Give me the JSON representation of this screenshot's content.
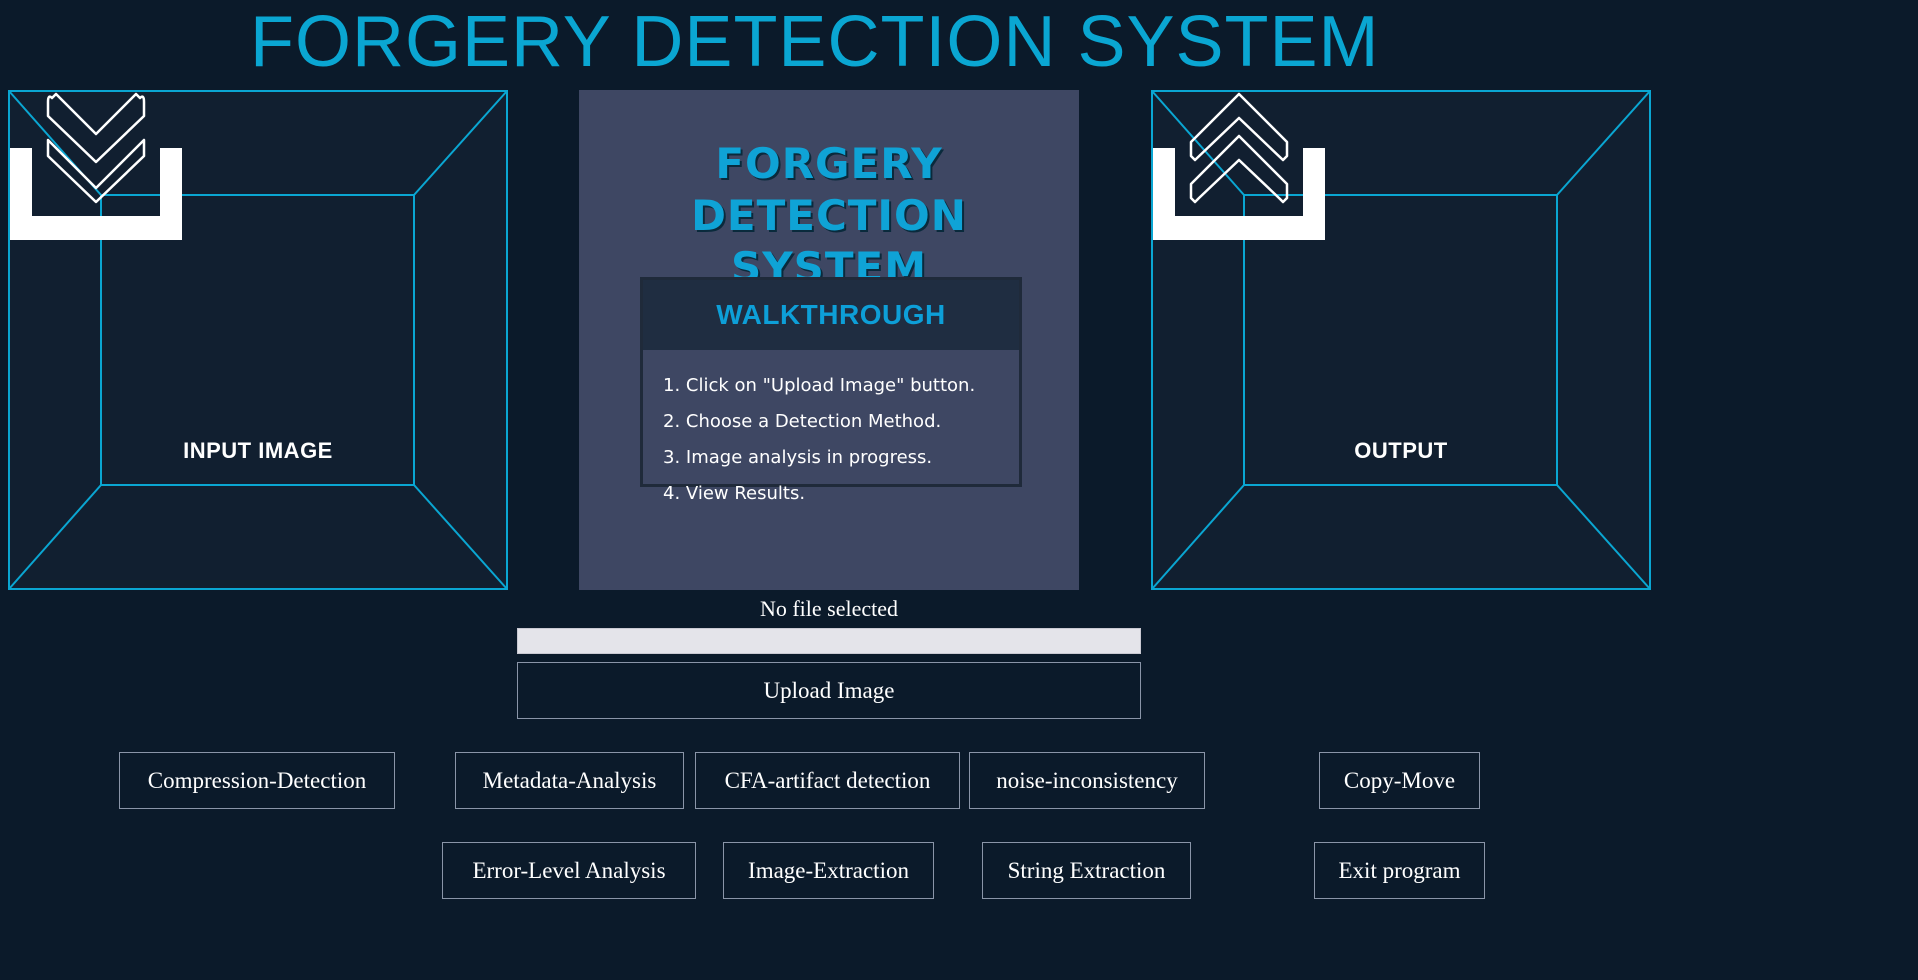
{
  "app": {
    "title": "FORGERY DETECTION SYSTEM"
  },
  "input_panel": {
    "label": "INPUT IMAGE",
    "icon": "download-tray-icon"
  },
  "output_panel": {
    "label": "OUTPUT",
    "icon": "upload-tray-icon"
  },
  "walkthrough": {
    "poster_title_line1": "FORGERY DETECTION",
    "poster_title_line2": "SYSTEM",
    "header": "WALKTHROUGH",
    "steps": [
      "1. Click on \"Upload Image\" button.",
      "2. Choose a Detection Method.",
      "3. Image analysis in progress.",
      "4. View Results."
    ]
  },
  "upload": {
    "status": "No file selected",
    "progress": 0,
    "button_label": "Upload Image"
  },
  "methods": {
    "compression": "Compression-Detection",
    "metadata": "Metadata-Analysis",
    "cfa": "CFA-artifact detection",
    "noise": "noise-inconsistency",
    "copy_move": "Copy-Move",
    "ela": "Error-Level Analysis",
    "image_extraction": "Image-Extraction",
    "string_extraction": "String Extraction",
    "exit": "Exit program"
  },
  "colors": {
    "background": "#0b1a2a",
    "accent": "#0aa6d2",
    "panel": "#3e4763"
  }
}
